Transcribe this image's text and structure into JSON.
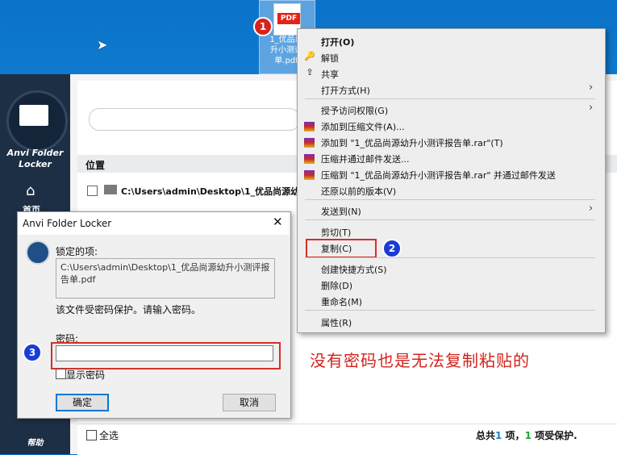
{
  "desktop": {
    "file": {
      "icon_tag": "PDF",
      "name_lines": [
        "1_优品尚",
        "升小测评",
        "单.pdf"
      ]
    },
    "step_badges": [
      "1",
      "2",
      "3"
    ]
  },
  "context_menu": {
    "items": [
      {
        "label": "打开(O)",
        "icon": "",
        "bold": true
      },
      {
        "label": "解锁",
        "icon": "key-icon"
      },
      {
        "label": "共享",
        "icon": "share-icon"
      },
      {
        "label": "打开方式(H)",
        "icon": "",
        "submenu": true
      },
      {
        "label": "授予访问权限(G)",
        "icon": "",
        "submenu": true
      },
      {
        "label": "添加到压缩文件(A)...",
        "icon": "winrar-icon"
      },
      {
        "label": "添加到 \"1_优品尚源幼升小测评报告单.rar\"(T)",
        "icon": "winrar-icon"
      },
      {
        "label": "压缩并通过邮件发送...",
        "icon": "winrar-icon"
      },
      {
        "label": "压缩到 \"1_优品尚源幼升小测评报告单.rar\" 并通过邮件发送",
        "icon": "winrar-icon"
      },
      {
        "label": "还原以前的版本(V)",
        "icon": ""
      },
      {
        "label": "发送到(N)",
        "icon": "",
        "submenu": true
      },
      {
        "label": "剪切(T)",
        "icon": ""
      },
      {
        "label": "复制(C)",
        "icon": "",
        "highlighted": true
      },
      {
        "label": "创建快捷方式(S)",
        "icon": ""
      },
      {
        "label": "删除(D)",
        "icon": ""
      },
      {
        "label": "重命名(M)",
        "icon": ""
      },
      {
        "label": "属性(R)",
        "icon": ""
      }
    ]
  },
  "app": {
    "title_lines": [
      "Anvi Folder",
      "Locker"
    ],
    "nav": {
      "home_label": "首页"
    },
    "help_label": "帮助",
    "list": {
      "column_header": "位置",
      "rows": [
        {
          "path": "C:\\Users\\admin\\Desktop\\1_优品尚源幼升小测评报告单.pdf"
        }
      ]
    },
    "footer": {
      "select_all": "全选",
      "summary_prefix": "总共",
      "total": "1",
      "summary_mid": " 项，",
      "protected": "1",
      "summary_suffix": " 项受保护."
    }
  },
  "dialog": {
    "title": "Anvi Folder Locker",
    "locked_item_label": "锁定的项:",
    "locked_path": "C:\\Users\\admin\\Desktop\\1_优品尚源幼升小测评报告单.pdf",
    "message": "该文件受密码保护。请输入密码。",
    "password_label": "密码:",
    "password_value": "",
    "show_password_label": "显示密码",
    "ok_label": "确定",
    "cancel_label": "取消"
  },
  "annotation": {
    "notice": "没有密码也是无法复制粘贴的"
  },
  "colors": {
    "desktop_blue": "#0a73c9",
    "sidebar_navy": "#1c2f45",
    "annotation_red": "#d2231c",
    "summary_blue": "#1e7bd6",
    "summary_green": "#22a43a"
  }
}
